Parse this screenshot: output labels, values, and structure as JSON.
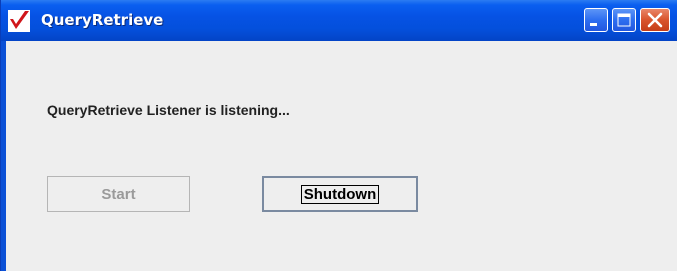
{
  "window": {
    "title": "QueryRetrieve",
    "controls": {
      "minimize": "minimize-icon",
      "maximize": "maximize-icon",
      "close": "close-icon"
    }
  },
  "content": {
    "status_message": "QueryRetrieve Listener is listening...",
    "buttons": {
      "start_label": "Start",
      "start_enabled": false,
      "shutdown_label": "Shutdown",
      "shutdown_focused": true
    }
  },
  "colors": {
    "titlebar": "#0450dc",
    "background": "#eeeeee",
    "close_button": "#d9542c"
  }
}
